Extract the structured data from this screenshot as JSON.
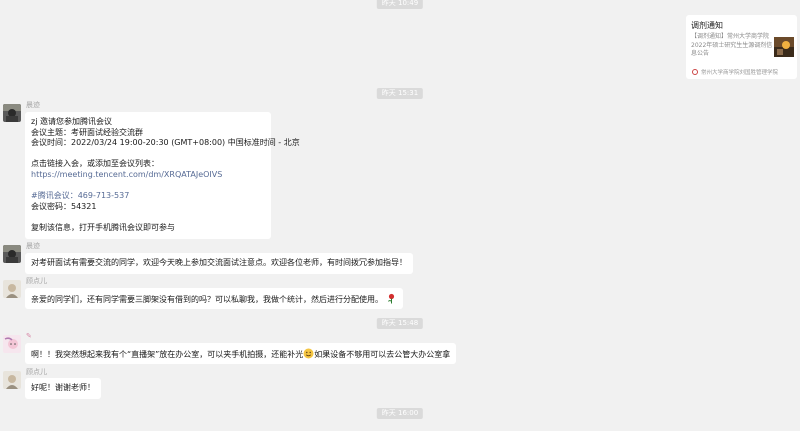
{
  "timestamps": [
    "昨天 10:49",
    "昨天 15:31",
    "昨天 15:48",
    "昨天 16:00"
  ],
  "card": {
    "title": "调剂通知",
    "description": "【调剂通知】常州大学商学院2022年硕士研究生生源调剂信息公告",
    "source": "常州大学商学院刘国胜管理学院"
  },
  "messages": [
    {
      "sender": "晨迹",
      "lines": [
        "zj 邀请您参加腾讯会议",
        "会议主题：考研面试经验交流群",
        "会议时间：2022/03/24 19:00-20:30 (GMT+08:00) 中国标准时间 - 北京",
        "",
        "点击链接入会，或添加至会议列表：",
        "https://meeting.tencent.com/dm/XRQATAJeOIVS",
        "",
        "#腾讯会议：469-713-537",
        "会议密码：54321",
        "",
        "复制该信息，打开手机腾讯会议即可参与"
      ]
    },
    {
      "sender": "晨迹",
      "text": "对考研面试有需要交流的同学，欢迎今天晚上参加交流面试注意点。欢迎各位老师，有时间拨冗参加指导！"
    },
    {
      "sender": "顾点儿",
      "text": "亲爱的同学们，还有同学需要三脚架没有借到的吗？可以私聊我，我做个统计，然后进行分配使用。"
    },
    {
      "sender": "",
      "text_before": "啊！！我突然想起来我有个“直播架”放在办公室，可以夹手机拍摄，还能补光",
      "text_after": "如果设备不够用可以去公管大办公室拿"
    },
    {
      "sender": "顾点儿",
      "text": "好呢！谢谢老师！"
    }
  ],
  "icons": {
    "rose": "rose-emoji",
    "smile": "smiling-face-emoji",
    "card_source": "university-logo-icon"
  },
  "colors": {
    "background": "#f1f1f1",
    "bubble": "#ffffff",
    "link": "#576b95",
    "timestamp_bg": "#dadada"
  }
}
